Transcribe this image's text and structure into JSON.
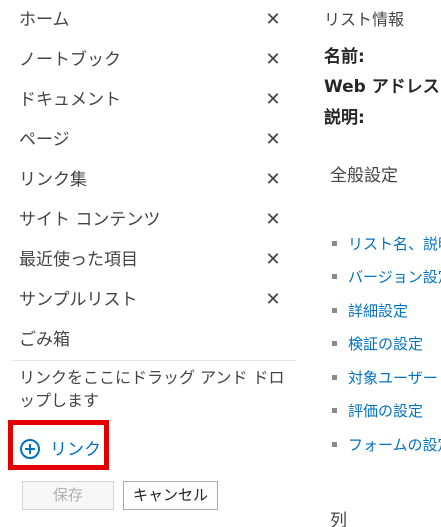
{
  "nav": {
    "items": [
      {
        "label": "ホーム",
        "remove_symbol": "✕"
      },
      {
        "label": "ノートブック",
        "remove_symbol": "✕"
      },
      {
        "label": "ドキュメント",
        "remove_symbol": "✕"
      },
      {
        "label": "ページ",
        "remove_symbol": "✕"
      },
      {
        "label": "リンク集",
        "remove_symbol": "✕"
      },
      {
        "label": "サイト コンテンツ",
        "remove_symbol": "✕"
      },
      {
        "label": "最近使った項目",
        "remove_symbol": "✕"
      },
      {
        "label": "サンプルリスト",
        "remove_symbol": "✕"
      },
      {
        "label": "ごみ箱"
      }
    ],
    "drop_hint": "リンクをここにドラッグ アンド ドロップします",
    "add_link_label": "リンク",
    "save_label": "保存",
    "cancel_label": "キャンセル"
  },
  "main": {
    "list_info_title": "リスト情報",
    "name_label": "名前:",
    "web_address_label": "Web アドレス:",
    "description_label": "説明:",
    "general_settings_title": "全般設定",
    "settings_links": [
      "リスト名、説明",
      "バージョン設定",
      "詳細設定",
      "検証の設定",
      "対象ユーザー",
      "評価の設定",
      "フォームの設定"
    ],
    "columns_title": "列"
  },
  "colors": {
    "accent": "#0072c6",
    "highlight": "#e50000",
    "text": "#444444"
  }
}
